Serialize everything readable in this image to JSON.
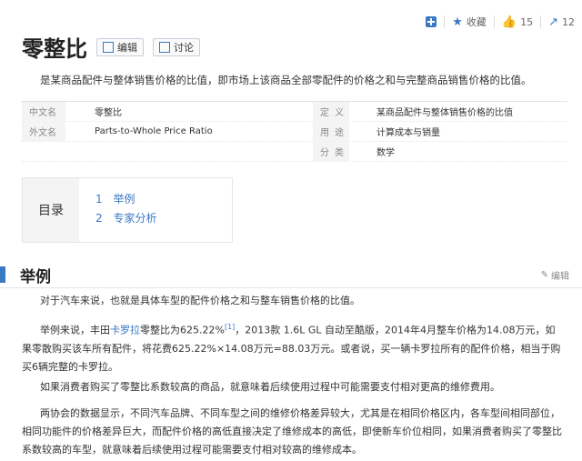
{
  "top_actions": {
    "collect_label": "收藏",
    "like_count": "15",
    "share_count": "12"
  },
  "header": {
    "title": "零整比",
    "edit_label": "编辑",
    "discuss_label": "讨论"
  },
  "summary": "是某商品配件与整体销售价格的比值，即市场上该商品全部零配件的价格之和与完整商品销售价格的比值。",
  "info": {
    "rows": [
      {
        "k1": "中文名",
        "v1": "零整比",
        "k2": "定义",
        "v2": "某商品配件与整体销售价格的比值"
      },
      {
        "k1": "外文名",
        "v1": "Parts-to-Whole Price Ratio",
        "k2": "用途",
        "v2": "计算成本与销量"
      },
      {
        "k1": "",
        "v1": "",
        "k2": "分类",
        "v2": "数学"
      }
    ]
  },
  "toc": {
    "label": "目录",
    "items": [
      {
        "num": "1",
        "label": "举例"
      },
      {
        "num": "2",
        "label": "专家分析"
      }
    ]
  },
  "section": {
    "title": "举例",
    "edit_label": "编辑"
  },
  "paragraphs": {
    "p1": "对于汽车来说，也就是具体车型的配件价格之和与整车销售价格的比值。",
    "p2_a": "举例来说，丰田",
    "p2_link": "卡罗拉",
    "p2_b": "零整比为625.22%",
    "p2_ref": "[1]",
    "p2_c": "，2013款 1.6L GL 自动至酷版，2014年4月整车价格为14.08万元，如果零散购买该车所有配件，将花费625.22%×14.08万元=88.03万元。或者说，买一辆卡罗拉所有的配件价格，相当于购买6辆完整的卡罗拉。",
    "p3": "如果消费者购买了零整比系数较高的商品，就意味着后续使用过程中可能需要支付相对更高的维修费用。",
    "p4": "两协会的数据显示，不同汽车品牌、不同车型之间的维修价格差异较大，尤其是在相同价格区内，各车型间相同部位，相同功能件的价格差异巨大，而配件价格的高低直接决定了维修成本的高低，即使新车价位相同，如果消费者购买了零整比系数较高的车型，就意味着后续使用过程可能需要支付相对较高的维修成本。"
  }
}
